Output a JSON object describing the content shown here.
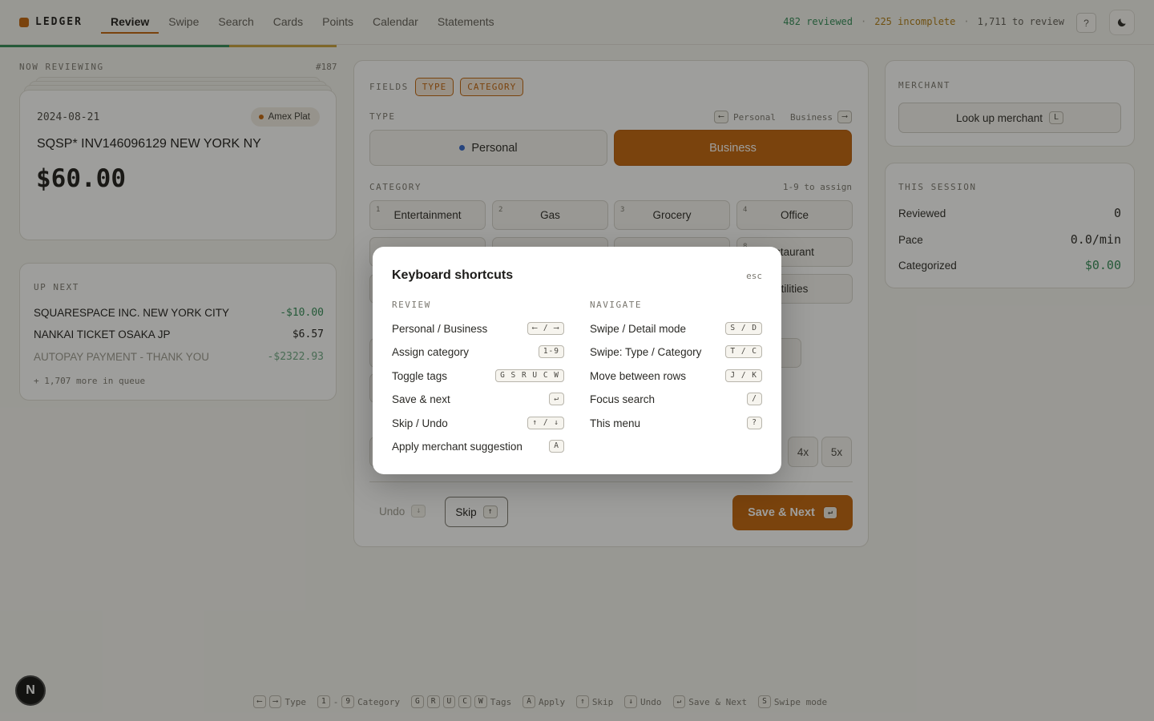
{
  "brand": {
    "name": "LEDGER"
  },
  "nav": {
    "tabs": [
      "Review",
      "Swipe",
      "Search",
      "Cards",
      "Points",
      "Calendar",
      "Statements"
    ]
  },
  "header_stats": {
    "reviewed": "482 reviewed",
    "incomplete": "225 incomplete",
    "to_review": "1,711 to review",
    "separator": "·"
  },
  "help_label": "?",
  "progress": {
    "reviewed_fraction": 0.68,
    "incomplete_fraction": 0.32
  },
  "now": {
    "label": "NOW REVIEWING",
    "id": "#187"
  },
  "transaction": {
    "date": "2024-08-21",
    "card": "Amex Plat",
    "merchant": "SQSP* INV146096129 NEW YORK NY",
    "amount": "$60.00"
  },
  "upnext": {
    "title": "UP NEXT",
    "items": [
      {
        "merchant": "SQUARESPACE INC. NEW YORK CITY",
        "amount": "-$10.00"
      },
      {
        "merchant": "NANKAI TICKET OSAKA JP",
        "amount": "$6.57"
      },
      {
        "merchant": "AUTOPAY PAYMENT - THANK YOU",
        "amount": "-$2322.93"
      }
    ],
    "more": "+ 1,707 more in queue"
  },
  "fields": {
    "label": "FIELDS",
    "chips": [
      "TYPE",
      "CATEGORY"
    ]
  },
  "type": {
    "label": "TYPE",
    "hint_left_key": "⟵",
    "hint_left": "Personal",
    "hint_right": "Business",
    "hint_right_key": "⟶",
    "personal": "Personal",
    "business": "Business",
    "selected": "Business"
  },
  "category": {
    "label": "CATEGORY",
    "hint": "1-9 to assign",
    "items": [
      {
        "num": "1",
        "label": "Entertainment"
      },
      {
        "num": "2",
        "label": "Gas"
      },
      {
        "num": "3",
        "label": "Grocery"
      },
      {
        "num": "4",
        "label": "Office"
      },
      {
        "num": "8",
        "label": "staurant"
      },
      {
        "num": "",
        "label": "tilities"
      },
      {
        "num": "",
        "label": "dit"
      }
    ]
  },
  "multipliers": [
    "4x",
    "5x"
  ],
  "actions": {
    "undo": "Undo",
    "undo_key": "↓",
    "skip": "Skip",
    "skip_key": "↑",
    "save": "Save & Next",
    "save_key": "↵"
  },
  "merchant": {
    "title": "MERCHANT",
    "lookup": "Look up merchant",
    "lookup_key": "L"
  },
  "session": {
    "title": "THIS SESSION",
    "rows": [
      {
        "label": "Reviewed",
        "value": "0"
      },
      {
        "label": "Pace",
        "value": "0.0/min"
      },
      {
        "label": "Categorized",
        "value": "$0.00"
      }
    ]
  },
  "hintbar": [
    {
      "keys": [
        "⟵",
        "⟶"
      ],
      "label": "Type"
    },
    {
      "keys": [
        "1",
        "-",
        "9"
      ],
      "label": "Category"
    },
    {
      "keys": [
        "G",
        "R",
        "U",
        "C",
        "W"
      ],
      "label": "Tags"
    },
    {
      "keys": [
        "A"
      ],
      "label": "Apply"
    },
    {
      "keys": [
        "↑"
      ],
      "label": "Skip"
    },
    {
      "keys": [
        "↓"
      ],
      "label": "Undo"
    },
    {
      "keys": [
        "↵"
      ],
      "label": "Save & Next"
    },
    {
      "keys": [
        "S"
      ],
      "label": "Swipe mode"
    }
  ],
  "modal": {
    "title": "Keyboard shortcuts",
    "close": "esc",
    "review_title": "REVIEW",
    "navigate_title": "NAVIGATE",
    "review": [
      {
        "label": "Personal / Business",
        "key": "⟵ / ⟶"
      },
      {
        "label": "Assign category",
        "key": "1-9"
      },
      {
        "label": "Toggle tags",
        "key": "G S R U C W"
      },
      {
        "label": "Save & next",
        "key": "↵"
      },
      {
        "label": "Skip / Undo",
        "key": "↑ / ↓"
      },
      {
        "label": "Apply merchant suggestion",
        "key": "A"
      }
    ],
    "navigate": [
      {
        "label": "Swipe / Detail mode",
        "key": "S / D"
      },
      {
        "label": "Swipe: Type / Category",
        "key": "T / C"
      },
      {
        "label": "Move between rows",
        "key": "J / K"
      },
      {
        "label": "Focus search",
        "key": "/"
      },
      {
        "label": "This menu",
        "key": "?"
      }
    ]
  },
  "dev_badge": "N",
  "colors": {
    "accent": "#c2620a",
    "green": "#2f8a55",
    "amber": "#b07b10"
  }
}
